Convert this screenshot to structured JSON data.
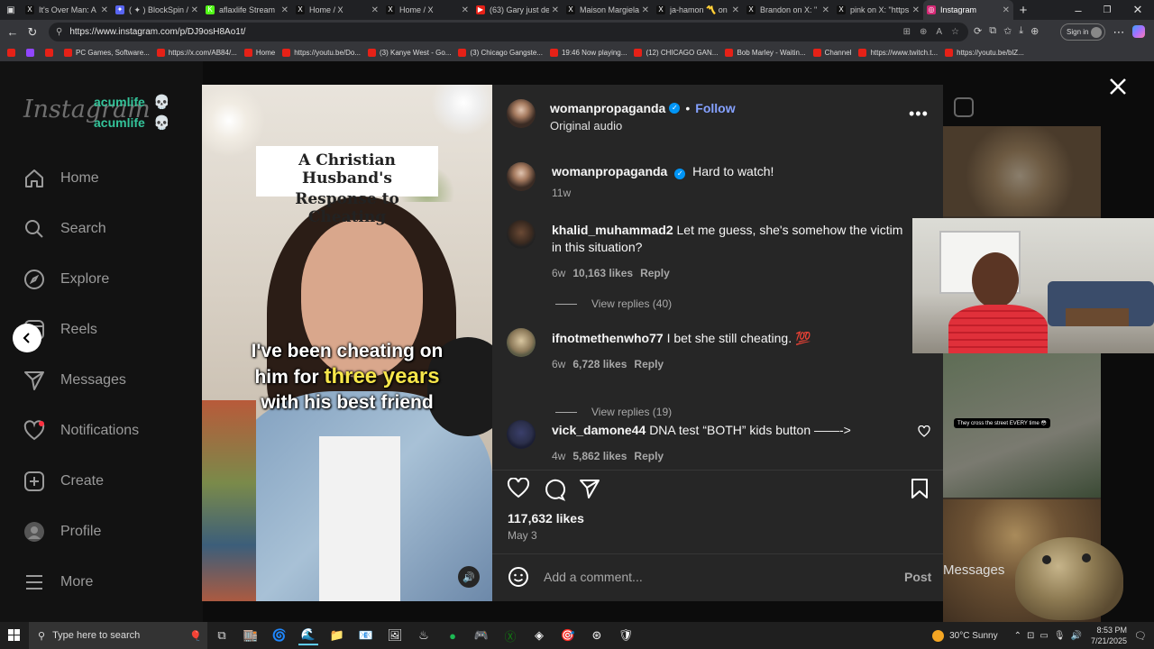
{
  "browser": {
    "tabs": [
      {
        "title": "It's Over Man: A",
        "fav": "X",
        "color": "#111"
      },
      {
        "title": "( ✦ ) BlockSpin /",
        "fav": "✦",
        "color": "#5865f2"
      },
      {
        "title": "aflaxlife Stream",
        "fav": "K",
        "color": "#53fc18"
      },
      {
        "title": "Home / X",
        "fav": "X",
        "color": "#111"
      },
      {
        "title": "Home / X",
        "fav": "X",
        "color": "#111"
      },
      {
        "title": "(63) Gary just de",
        "fav": "▶",
        "color": "#e62117"
      },
      {
        "title": "Maison Margiela",
        "fav": "X",
        "color": "#111"
      },
      {
        "title": "ja-hamon 〽️ on",
        "fav": "X",
        "color": "#111"
      },
      {
        "title": "Brandon on X: \"",
        "fav": "X",
        "color": "#111"
      },
      {
        "title": "pink on X: \"https",
        "fav": "X",
        "color": "#111"
      },
      {
        "title": "Instagram",
        "fav": "◎",
        "color": "#d62976"
      }
    ],
    "url": "https://www.instagram.com/p/DJ9osH8Ao1t/",
    "sign_in": "Sign in",
    "bookmarks": [
      "PC Games, Software...",
      "https://x.com/AB84/...",
      "Home",
      "https://youtu.be/Do...",
      "(3) Kanye West - Go...",
      "(3) Chicago Gangste...",
      "19:46 Now playing...",
      "(12) CHICAGO GAN...",
      "Bob Marley - Waitin...",
      "Channel",
      "https://www.twitch.t...",
      "https://youtu.be/blZ..."
    ]
  },
  "sidebar": {
    "logo": "Instagram",
    "overlay_text_1": "acumlife",
    "overlay_text_2": "acumlife",
    "items": [
      "Home",
      "Search",
      "Explore",
      "Reels",
      "Messages",
      "Notifications",
      "Create",
      "Profile",
      "More"
    ]
  },
  "post": {
    "media_caption_line1": "A Christian Husband's",
    "media_caption_line2": "Response to Cheating",
    "subtitle_1": "I've been cheating on",
    "subtitle_2a": "him for ",
    "subtitle_2b": "three years",
    "subtitle_3": "with his best friend",
    "author": "womanpropaganda",
    "follow": "Follow",
    "audio": "Original audio",
    "caption_text": "Hard to watch!",
    "caption_time": "11w",
    "comments": [
      {
        "user": "khalid_muhammad2",
        "text": "Let me guess, she's somehow the victim in this situation?",
        "time": "6w",
        "likes": "10,163 likes",
        "reply": "Reply",
        "view_replies": "View replies (40)"
      },
      {
        "user": "ifnotmethenwho77",
        "text": "I bet she still cheating. 💯",
        "time": "6w",
        "likes": "6,728 likes",
        "reply": "Reply",
        "view_replies": "View replies (19)"
      },
      {
        "user": "vick_damone44",
        "text": "DNA test “BOTH” kids button ——->",
        "time": "4w",
        "likes": "5,862 likes",
        "reply": "Reply"
      }
    ],
    "like_count": "117,632 likes",
    "date": "May 3",
    "comment_placeholder": "Add a comment...",
    "post_button": "Post"
  },
  "background": {
    "caption": "They cross the street EVERY time 😳",
    "messages": "Messages"
  },
  "taskbar": {
    "search_placeholder": "Type here to search",
    "weather": "30°C  Sunny",
    "time": "8:53 PM",
    "date": "7/21/2025"
  }
}
